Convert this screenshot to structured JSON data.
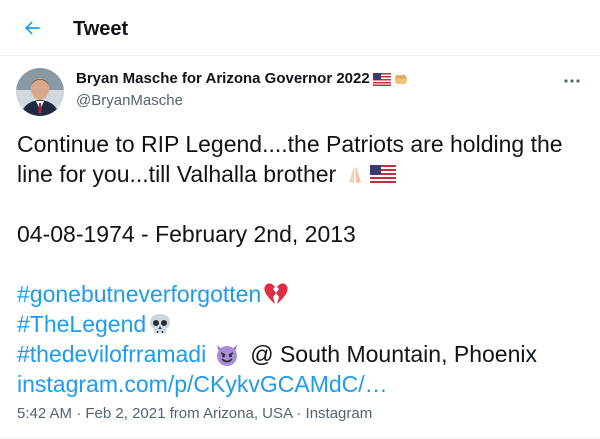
{
  "header": {
    "title": "Tweet",
    "back_icon": "arrow-left-icon"
  },
  "tweet": {
    "author": {
      "name": "Bryan Masche for Arizona Governor 2022",
      "name_emojis": [
        "us-flag-icon",
        "fist-icon"
      ],
      "handle": "@BryanMasche"
    },
    "more_icon": "more-dots-icon",
    "text": {
      "line1": "Continue to RIP Legend....the Patriots are holding the",
      "line2": "line for you...till Valhalla brother",
      "line2_emojis": [
        "praying-hands-icon",
        "us-flag-icon"
      ],
      "dates": "04-08-1974 - February 2nd, 2013",
      "hashtag1": "#gonebutneverforgotten",
      "hashtag1_emoji": "broken-heart-icon",
      "hashtag2": "#TheLegend",
      "hashtag2_emoji": "skull-icon",
      "hashtag3": "#thedevilofrramadi",
      "hashtag3_emoji": "smiling-devil-icon",
      "location": "@ South Mountain, Phoenix",
      "link": "instagram.com/p/CKykvGCAMdC/…"
    },
    "meta": {
      "time": "5:42 AM",
      "sep1": " · ",
      "date": "Feb 2, 2021",
      "from": " from ",
      "place": "Arizona, USA",
      "sep2": " · ",
      "source": "Instagram"
    },
    "colors": {
      "link": "#1d9bf0",
      "text": "#0f1419",
      "secondary": "#536471"
    }
  }
}
